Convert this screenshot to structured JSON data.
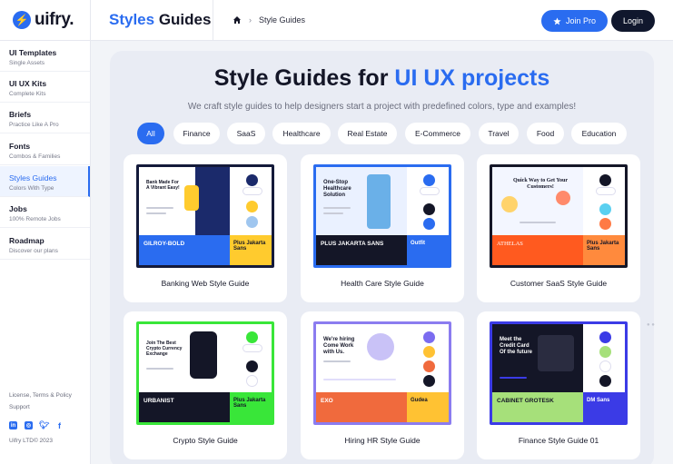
{
  "app": {
    "logo_text": "uifry.",
    "logo_glyph": "⚡",
    "brand_color": "#2a6cf0"
  },
  "header": {
    "title_part1": "Styles",
    "title_part2": "Guides",
    "breadcrumb_current": "Style Guides",
    "join_label": "Join Pro",
    "login_label": "Login"
  },
  "sidebar": {
    "items": [
      {
        "title": "UI Templates",
        "sub": "Single Assets"
      },
      {
        "title": "UI UX Kits",
        "sub": "Complete Kits"
      },
      {
        "title": "Briefs",
        "sub": "Practice Like A Pro"
      },
      {
        "title": "Fonts",
        "sub": "Combos & Families"
      },
      {
        "title": "Styles Guides",
        "sub": "Colors With Type",
        "active": true
      },
      {
        "title": "Jobs",
        "sub": "100% Remote Jobs"
      },
      {
        "title": "Roadmap",
        "sub": "Discover our plans"
      }
    ],
    "footer_links": "License, Terms & Policy",
    "support": "Support",
    "socials": [
      "linkedin-icon",
      "instagram-icon",
      "twitter-icon",
      "facebook-icon"
    ],
    "copyright": "Uifry LTD© 2023"
  },
  "hero": {
    "title_prefix": "Style Guides for",
    "title_accent": "UI UX projects",
    "subtitle": "We craft style guides to help designers start a project with predefined colors, type and examples!"
  },
  "filters": [
    "All",
    "Finance",
    "SaaS",
    "Healthcare",
    "Real Estate",
    "E-Commerce",
    "Travel",
    "Food",
    "Education"
  ],
  "active_filter": "All",
  "cards": [
    {
      "title": "Banking Web Style Guide",
      "font_a": "GILROY-BOLD",
      "font_b": "Plus Jakarta Sans",
      "headline": "Bank Made For A Vibrant Easy!",
      "colors": {
        "border": "#141a3a",
        "top": "#1b2a6b",
        "font_a_bg": "#2a6cf0",
        "font_b_bg": "#ffcb2e",
        "dots": [
          "#1b2a6b",
          "#ffcb2e",
          "#9fc6ef",
          "#ffffff"
        ]
      }
    },
    {
      "title": "Health Care Style Guide",
      "font_a": "PLUS JAKARTA SANS",
      "font_b": "Outfit",
      "headline": "One-Stop Healthcare Solution",
      "colors": {
        "border": "#2a6cf0",
        "top": "#eaf1ff",
        "font_a_bg": "#141627",
        "font_b_bg": "#2a6cf0",
        "dots": [
          "#2a6cf0",
          "#ffffff",
          "#141627",
          "#2a6cf0"
        ]
      }
    },
    {
      "title": "Customer SaaS Style Guide",
      "font_a": "ATHELAS",
      "font_b": "Plus Jakarta Sans",
      "headline": "Quick Way to Get Your Customers!",
      "colors": {
        "border": "#141627",
        "top": "#f3f6ff",
        "font_a_bg": "#ff5a1f",
        "font_b_bg": "#ff8a3d",
        "dots": [
          "#141627",
          "#ffffff",
          "#5ad0f0",
          "#ff7a45"
        ]
      }
    },
    {
      "title": "Crypto Style Guide",
      "font_a": "URBANIST",
      "font_b": "Plus Jakarta Sans",
      "headline": "Join The Best Crypto Currency Exchange",
      "colors": {
        "border": "#39e639",
        "top": "#ffffff",
        "font_a_bg": "#141627",
        "font_b_bg": "#39e639",
        "dots": [
          "#39e639",
          "#ffffff",
          "#141627",
          "#ffffff"
        ]
      }
    },
    {
      "title": "Hiring HR Style Guide",
      "font_a": "EXO",
      "font_b": "Gudea",
      "headline": "We're hiring Come Work with Us.",
      "colors": {
        "border": "#8b7cf0",
        "top": "#ffffff",
        "font_a_bg": "#f06a3d",
        "font_b_bg": "#ffc233",
        "dots": [
          "#7b6cf0",
          "#ffc233",
          "#f06a3d",
          "#141627"
        ]
      }
    },
    {
      "title": "Finance Style Guide 01",
      "font_a": "CABINET GROTESK",
      "font_b": "DM Sans",
      "headline": "Meet the Credit Card Of the future",
      "colors": {
        "border": "#3b3be6",
        "top": "#141627",
        "font_a_bg": "#a6e07a",
        "font_b_bg": "#3b3be6",
        "dots": [
          "#3b3be6",
          "#a6e07a",
          "#ffffff",
          "#141627"
        ]
      }
    }
  ]
}
